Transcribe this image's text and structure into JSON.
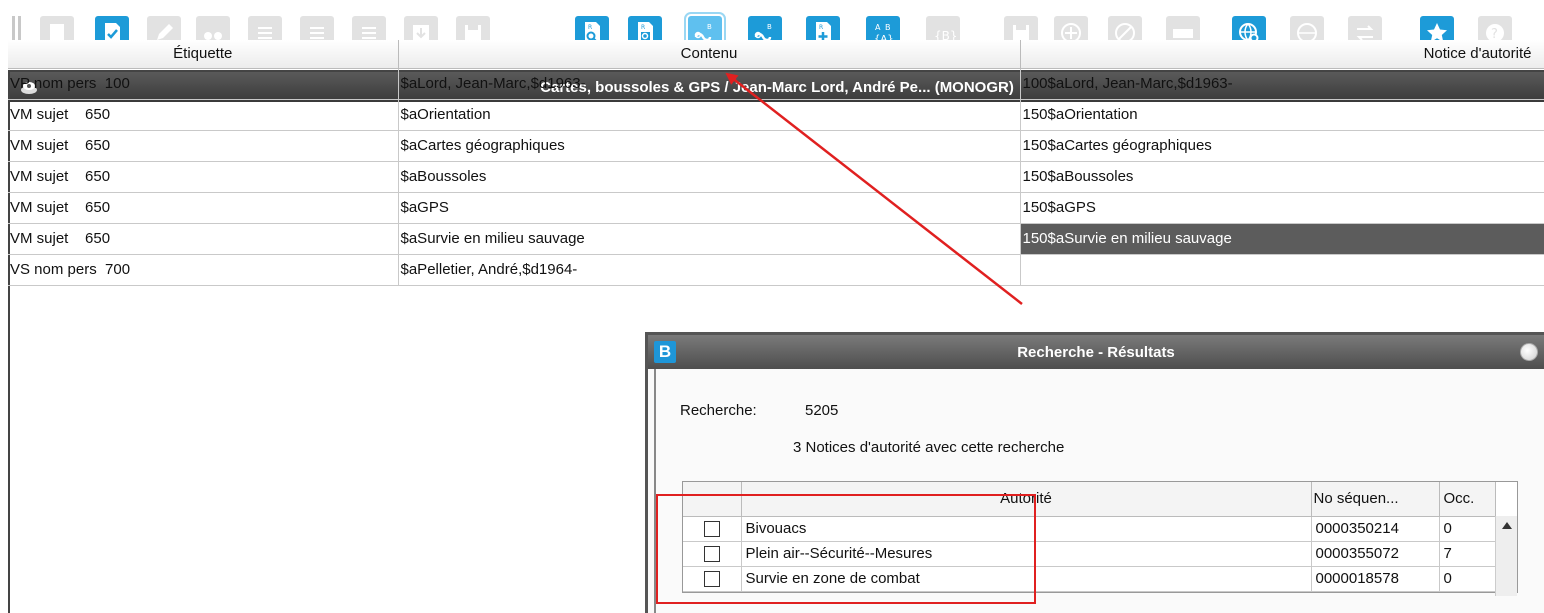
{
  "toolbar": {
    "buttons": [
      {
        "icon": "notice-grey-icon",
        "enabled": false
      },
      {
        "icon": "validate-notice-icon",
        "enabled": true
      },
      {
        "icon": "edit-pencil-icon",
        "enabled": false
      },
      {
        "icon": "binoculars-icon",
        "enabled": false
      },
      {
        "icon": "list-icon",
        "enabled": false
      },
      {
        "icon": "list-icon",
        "enabled": false
      },
      {
        "icon": "list-icon",
        "enabled": false
      },
      {
        "icon": "download-icon",
        "enabled": false
      },
      {
        "icon": "save-icon",
        "enabled": false
      },
      {
        "icon": "search-record-icon",
        "enabled": true
      },
      {
        "icon": "search-record-alt-icon",
        "enabled": true
      },
      {
        "icon": "link-authority-icon",
        "enabled": true,
        "active": true
      },
      {
        "icon": "link-authority-alt-icon",
        "enabled": true
      },
      {
        "icon": "add-record-icon",
        "enabled": true
      },
      {
        "icon": "authority-ab-icon",
        "enabled": true
      },
      {
        "icon": "bracket-b-icon",
        "enabled": false
      },
      {
        "icon": "save-icon",
        "enabled": false
      },
      {
        "icon": "target-icon",
        "enabled": false
      },
      {
        "icon": "cancel-icon",
        "enabled": false
      },
      {
        "icon": "keyboard-icon",
        "enabled": false
      },
      {
        "icon": "web-search-icon",
        "enabled": true
      },
      {
        "icon": "globe-icon",
        "enabled": false
      },
      {
        "icon": "transfer-icon",
        "enabled": false
      },
      {
        "icon": "star-icon",
        "enabled": true
      },
      {
        "icon": "help-icon",
        "enabled": false
      }
    ]
  },
  "main_window": {
    "title": "Cartes, boussoles & GPS / Jean-Marc Lord, André Pe... (MONOGR)",
    "columns": [
      "Étiquette",
      "Contenu",
      "Notice d'autorité"
    ],
    "rows": [
      {
        "etiquette": "VP nom pers  100",
        "contenu": "$aLord, Jean-Marc,$d1963-",
        "notice": "100$aLord, Jean-Marc,$d1963-"
      },
      {
        "etiquette": "VM sujet    650",
        "contenu": "$aOrientation",
        "notice": "150$aOrientation"
      },
      {
        "etiquette": "VM sujet    650",
        "contenu": "$aCartes géographiques",
        "notice": "150$aCartes géographiques"
      },
      {
        "etiquette": "VM sujet    650",
        "contenu": "$aBoussoles",
        "notice": "150$aBoussoles"
      },
      {
        "etiquette": "VM sujet    650",
        "contenu": "$aGPS",
        "notice": "150$aGPS"
      },
      {
        "etiquette": "VM sujet    650",
        "contenu": "$aSurvie en milieu sauvage",
        "notice": "150$aSurvie en milieu sauvage",
        "selected": true
      },
      {
        "etiquette": "VS nom pers  700",
        "contenu": "$aPelletier, André,$d1964-",
        "notice": ""
      }
    ]
  },
  "dialog": {
    "icon_letter": "B",
    "title": "Recherche - Résultats",
    "search_label": "Recherche:",
    "search_value": "5205",
    "result_count": "3 Notices d'autorité avec cette recherche",
    "columns": [
      "",
      "Autorité",
      "No séquen...",
      "Occ."
    ],
    "results": [
      {
        "authority": "Bivouacs",
        "seq": "0000350214",
        "occ": "0"
      },
      {
        "authority": "Plein air--Sécurité--Mesures",
        "seq": "0000355072",
        "occ": "7"
      },
      {
        "authority": "Survie en zone de combat",
        "seq": "0000018578",
        "occ": "0"
      }
    ]
  },
  "colors": {
    "accent_blue": "#1d9bd8",
    "annotation_red": "#e02020",
    "selected_row": "#5c5c5c"
  }
}
